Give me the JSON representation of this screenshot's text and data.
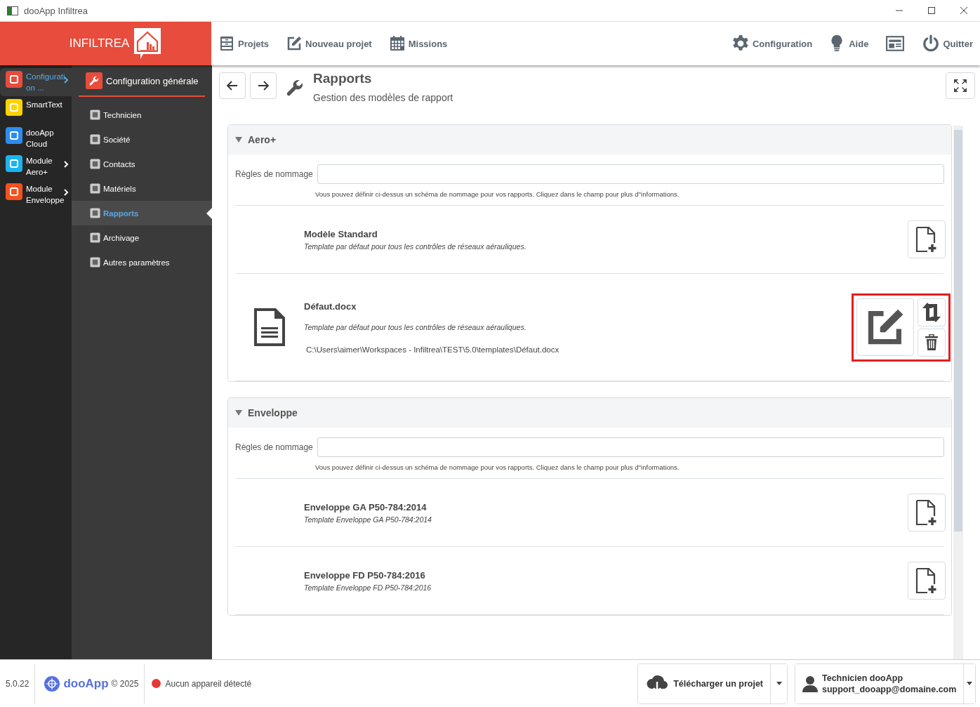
{
  "window": {
    "title": "dooApp Infiltrea"
  },
  "header": {
    "logo_text": "INFILTREA",
    "nav": [
      {
        "label": "Projets"
      },
      {
        "label": "Nouveau projet"
      },
      {
        "label": "Missions"
      }
    ],
    "right_nav": [
      {
        "kind": "labeled",
        "label": "Configuration"
      },
      {
        "kind": "labeled",
        "label": "Aide"
      },
      {
        "kind": "icon_only"
      },
      {
        "kind": "labeled",
        "label": "Quitter"
      }
    ]
  },
  "rail": {
    "items": [
      {
        "label": "Configuration ...",
        "selected": true,
        "expandable": true,
        "color": "#e74c3c"
      },
      {
        "label": "SmartText",
        "selected": false,
        "expandable": false,
        "color": "#ffd200"
      },
      {
        "label": "dooApp Cloud",
        "selected": false,
        "expandable": false,
        "color": "#2d8cf0"
      },
      {
        "label": "Module Aero+",
        "selected": false,
        "expandable": true,
        "color": "#1ab4f0"
      },
      {
        "label": "Module Enveloppe",
        "selected": false,
        "expandable": true,
        "color": "#f4511e"
      }
    ]
  },
  "submenu": {
    "title": "Configuration générale",
    "items": [
      {
        "label": "Technicien",
        "selected": false
      },
      {
        "label": "Société",
        "selected": false
      },
      {
        "label": "Contacts",
        "selected": false
      },
      {
        "label": "Matériels",
        "selected": false
      },
      {
        "label": "Rapports",
        "selected": true
      },
      {
        "label": "Archivage",
        "selected": false
      },
      {
        "label": "Autres paramètres",
        "selected": false
      }
    ]
  },
  "page": {
    "title": "Rapports",
    "subtitle": "Gestion des modèles de rapport"
  },
  "sections": [
    {
      "title": "Aero+",
      "expanded": true,
      "naming_label": "Règles de nommage",
      "hint": "Vous pouvez définir ci-dessus un schéma de nommage pour vos rapports. Cliquez dans le champ pour plus d''informations.",
      "templates": [
        {
          "kind": "builtin",
          "name": "Modèle Standard",
          "description": "Template par défaut pour tous les contrôles de réseaux aérauliques.",
          "highlighted": false
        },
        {
          "kind": "file",
          "name": "Défaut.docx",
          "description": "Template par défaut pour tous les contrôles de réseaux aérauliques.",
          "path": "C:\\Users\\aimer\\Workspaces - Infiltrea\\TEST\\5.0\\templates\\Défaut.docx",
          "highlighted": true
        }
      ]
    },
    {
      "title": "Enveloppe",
      "expanded": true,
      "naming_label": "Règles de nommage",
      "hint": "Vous pouvez définir ci-dessus un schéma de nommage pour vos rapports. Cliquez dans le champ pour plus d''informations.",
      "templates": [
        {
          "kind": "builtin",
          "name": "Enveloppe GA P50-784:2014",
          "description": "Template Enveloppe GA P50-784:2014",
          "highlighted": false
        },
        {
          "kind": "builtin",
          "name": "Enveloppe FD P50-784:2016",
          "description": "Template Enveloppe FD P50-784:2016",
          "highlighted": false
        }
      ]
    }
  ],
  "footer": {
    "version": "5.0.22",
    "brand": "dooApp",
    "copyright": "© 2025",
    "status": {
      "text": "Aucun appareil détecté",
      "color": "#e53935"
    },
    "download": "Télécharger un projet",
    "user_name": "Technicien dooApp",
    "user_email": "support_dooapp@domaine.com"
  }
}
